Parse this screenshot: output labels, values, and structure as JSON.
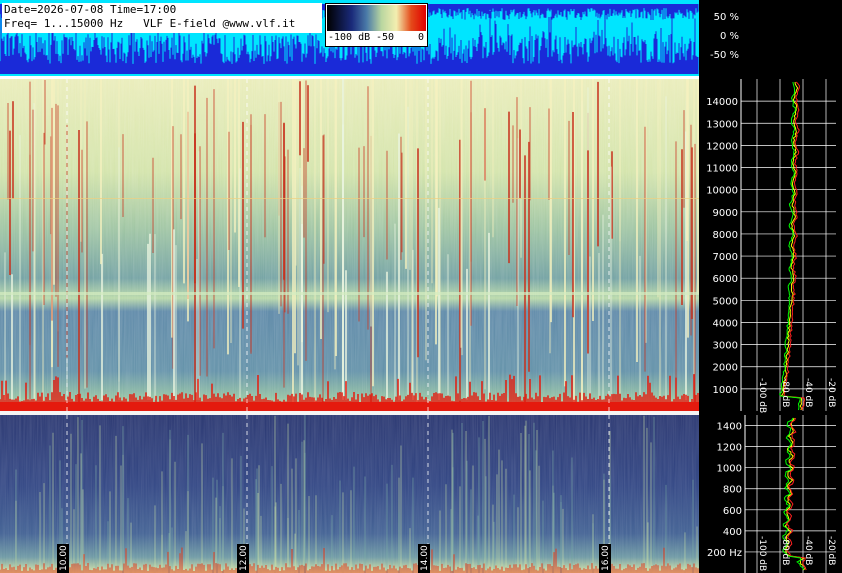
{
  "header": {
    "line1": "Date=2026-07-08 Time=17:00",
    "line2": "Freq= 1...15000 Hz   VLF E-field @www.vlf.it"
  },
  "color_scale": {
    "labels": [
      "-100 dB",
      "-50",
      "0"
    ],
    "colors": [
      "#000000",
      "#1a2a7a",
      "#4a7aa8",
      "#b9d6a0",
      "#f3eeb0",
      "#e44a1a",
      "#e00000"
    ]
  },
  "waveform_panel": {
    "labels": [
      "50 %",
      "0 %",
      "-50 %"
    ],
    "background": "#00e5ff",
    "trace_color": "#1a2ad8"
  },
  "chart_data": [
    {
      "type": "heatmap",
      "title": "",
      "xlabel": "",
      "ylabel": "",
      "x_ticks": [
        "10.00",
        "12.00",
        "14.00",
        "16.00"
      ],
      "y_ticks_upper": [
        "14000",
        "13000",
        "12000",
        "11000",
        "10000",
        "9000",
        "8000",
        "7000",
        "6000",
        "5000",
        "4000",
        "3000",
        "2000",
        "1000"
      ],
      "y_ticks_lower": [
        "1400",
        "1200",
        "1000",
        "800",
        "600",
        "400",
        "200 Hz"
      ],
      "ylim_upper": [
        0,
        15000
      ],
      "ylim_lower": [
        0,
        1500
      ]
    },
    {
      "type": "line",
      "title": "",
      "x_tick_labels": [
        "-100 dB",
        "-80 dB",
        "-40 dB",
        "-20 dB"
      ],
      "series": [
        {
          "color": "#ffff00"
        },
        {
          "color": "#ff2020"
        },
        {
          "color": "#00ff00"
        }
      ],
      "grid": true
    }
  ]
}
